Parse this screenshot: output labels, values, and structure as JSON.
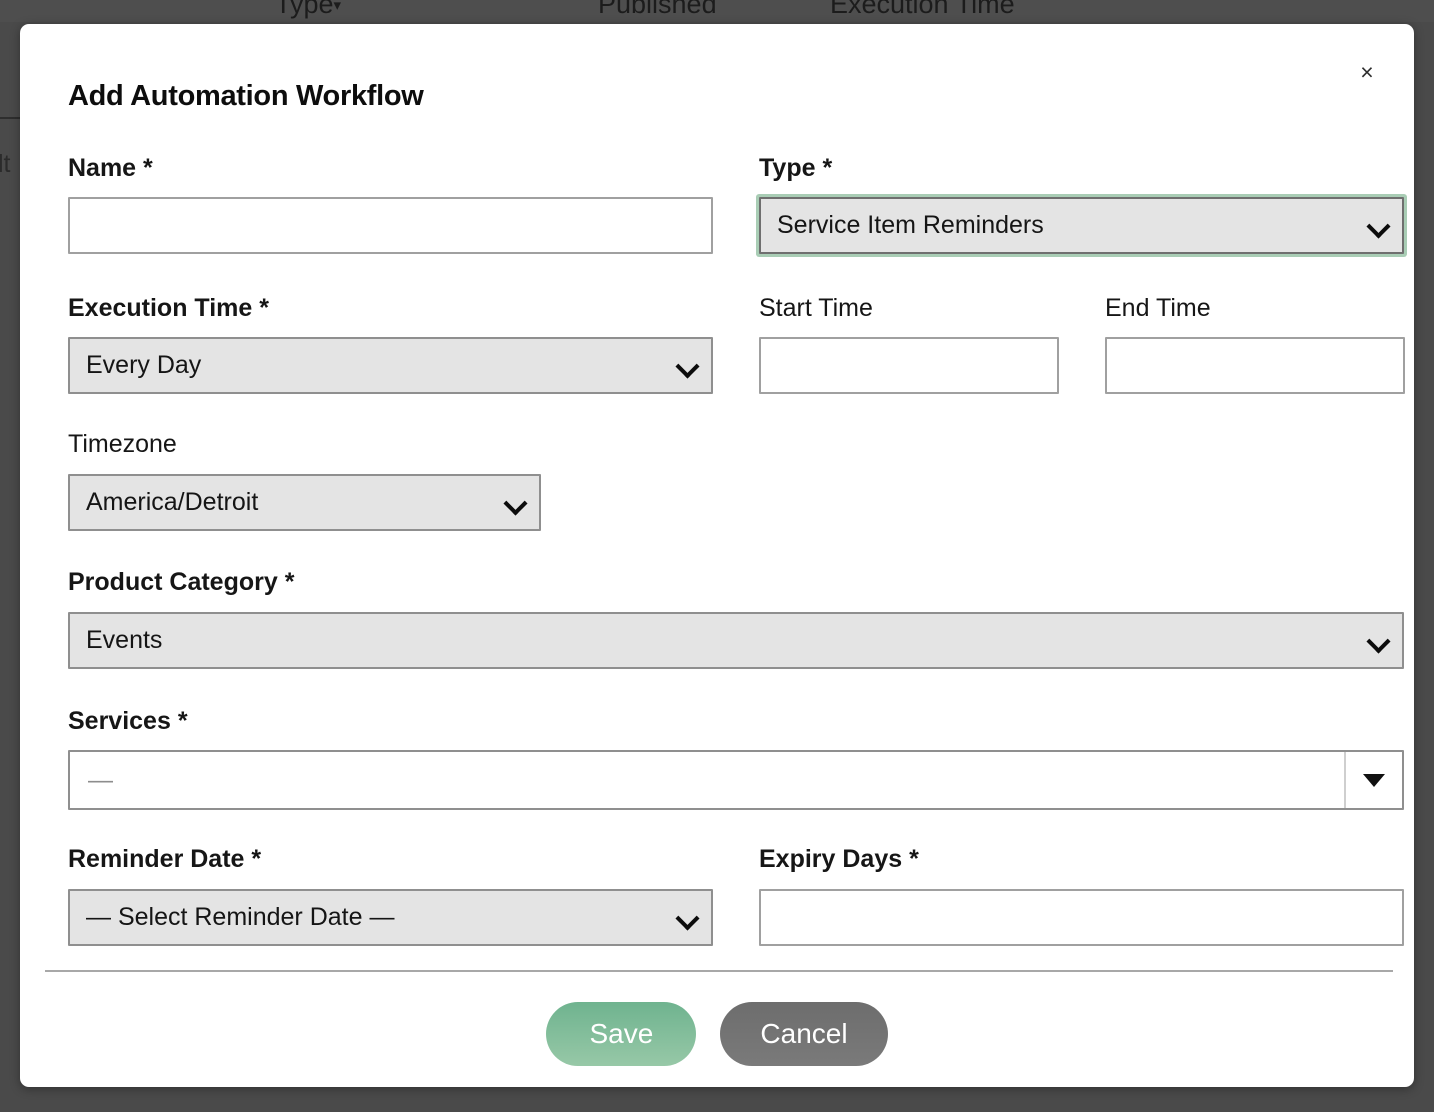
{
  "background": {
    "table_columns": [
      {
        "label": "Type",
        "caret": "▾"
      },
      {
        "label": "Published",
        "caret": ""
      },
      {
        "label": "Execution Time",
        "caret": ""
      }
    ],
    "left_fragment": "lt"
  },
  "modal": {
    "title": "Add Automation Workflow",
    "close_label": "×",
    "fields": {
      "name": {
        "label": "Name *",
        "value": "",
        "placeholder": ""
      },
      "type": {
        "label": "Type *",
        "value": "Service Item Reminders",
        "focused": true
      },
      "execution_time": {
        "label": "Execution Time *",
        "value": "Every Day"
      },
      "start_time": {
        "label": "Start Time",
        "value": "",
        "placeholder": ""
      },
      "end_time": {
        "label": "End Time",
        "value": "",
        "placeholder": ""
      },
      "timezone": {
        "label": "Timezone",
        "value": "America/Detroit"
      },
      "product_category": {
        "label": "Product Category *",
        "value": "Events"
      },
      "services": {
        "label": "Services *",
        "value": "—"
      },
      "reminder_date": {
        "label": "Reminder Date *",
        "value": "— Select Reminder Date —"
      },
      "expiry_days": {
        "label": "Expiry Days *",
        "value": "",
        "placeholder": ""
      }
    },
    "footer": {
      "save_label": "Save",
      "cancel_label": "Cancel"
    }
  },
  "colors": {
    "accent_green": "#7fbd9b",
    "focus_ring_green": "#a9cdb5",
    "cancel_grey": "#737373",
    "select_fill": "#e4e4e4",
    "backdrop": "#4a4a4a"
  }
}
